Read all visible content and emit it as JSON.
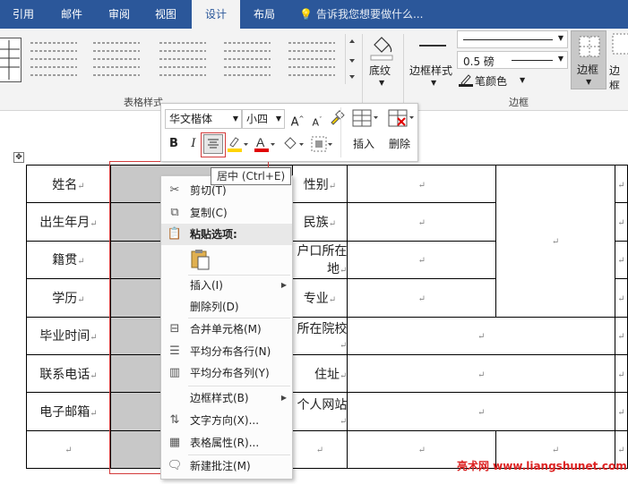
{
  "tabs": [
    "引用",
    "邮件",
    "审阅",
    "视图",
    "设计",
    "布局"
  ],
  "active_tab": "设计",
  "tell_me_placeholder": "告诉我您想要做什么...",
  "ribbon": {
    "table_styles_group": "表格样式",
    "borders_group": "边框",
    "shading_label": "底纹",
    "border_styles_label": "边框样式",
    "pen_weight": "0.5 磅",
    "pen_color_label": "笔颜色",
    "borders_label": "边框",
    "border_painter_label": "边框"
  },
  "minibar": {
    "font": "华文楷体",
    "size": "小四",
    "grow_font": "A",
    "shrink_font": "A",
    "bold": "B",
    "italic": "I",
    "insert_label": "插入",
    "delete_label": "删除"
  },
  "tooltip": "居中 (Ctrl+E)",
  "context_menu": {
    "cut": "剪切(T)",
    "copy": "复制(C)",
    "paste_options": "粘贴选项:",
    "insert": "插入(I)",
    "delete_column": "删除列(D)",
    "merge_cells": "合并单元格(M)",
    "distribute_rows": "平均分布各行(N)",
    "distribute_columns": "平均分布各列(Y)",
    "border_styles": "边框样式(B)",
    "text_direction": "文字方向(X)...",
    "table_properties": "表格属性(R)...",
    "new_comment": "新建批注(M)"
  },
  "table": {
    "row_labels": [
      "姓名",
      "出生年月",
      "籍贯",
      "学历",
      "毕业时间",
      "联系电话",
      "电子邮箱",
      ""
    ],
    "col3_labels": [
      "性别",
      "民族",
      "户口所在地",
      "专业",
      "所在院校",
      "住址",
      "个人网站",
      ""
    ],
    "mark": "↵"
  },
  "watermark": "亮术网 www.liangshunet.com",
  "colors": {
    "tab_bar": "#2b579a",
    "ribbon": "#f3f3f3",
    "highlight_yellow": "#ffd400",
    "font_red": "#e00000",
    "selection_gray": "#c8c8c8",
    "red_box": "#d43b3b"
  }
}
